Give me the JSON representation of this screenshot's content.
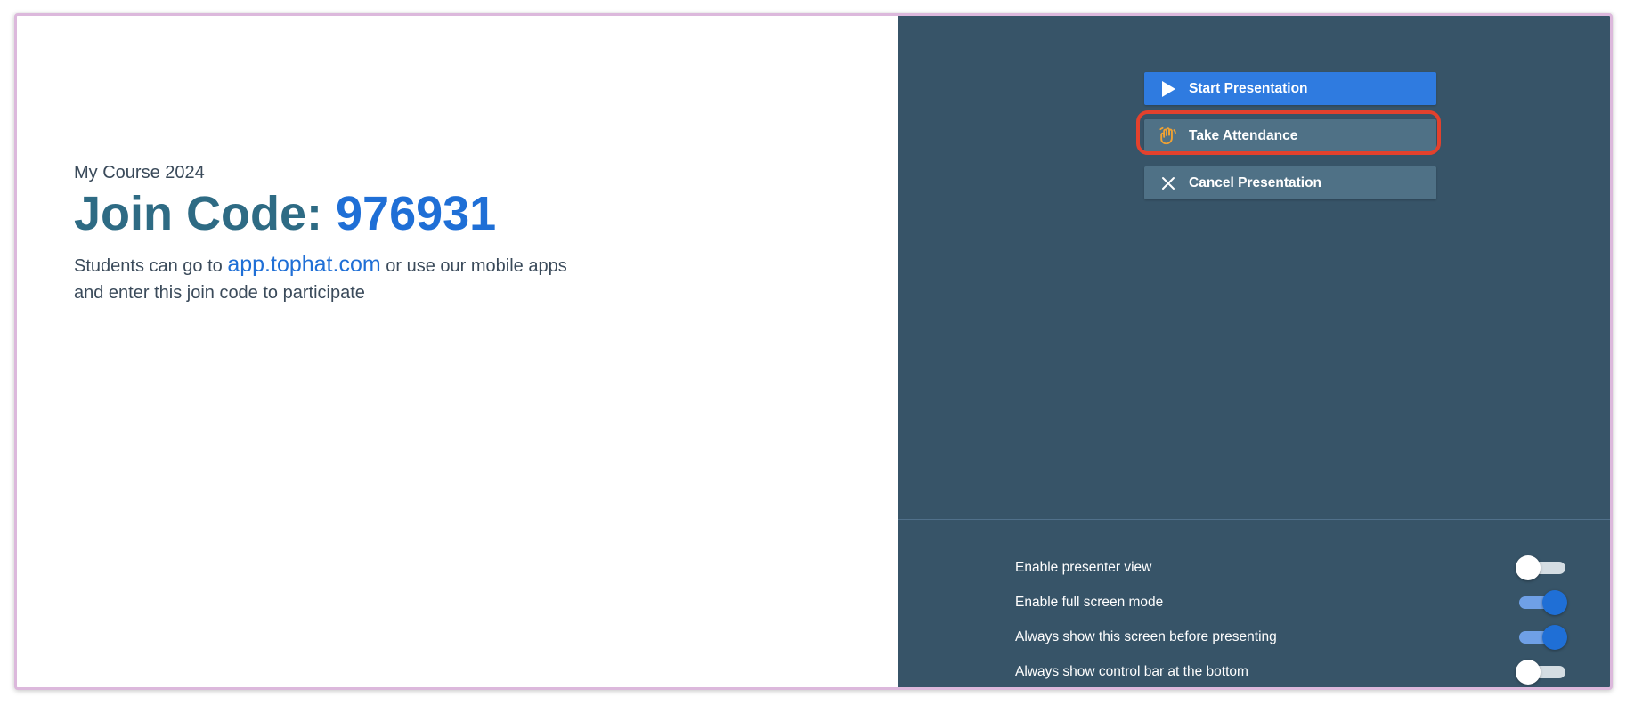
{
  "course": {
    "name": "My Course 2024",
    "join_label": "Join Code: ",
    "join_code": "976931",
    "desc_prefix": "Students can go to ",
    "link_text": "app.tophat.com",
    "desc_suffix": " or use our mobile apps and enter this join code to participate"
  },
  "actions": {
    "start_label": "Start Presentation",
    "attendance_label": "Take Attendance",
    "cancel_label": "Cancel Presentation"
  },
  "settings": [
    {
      "label": "Enable presenter view",
      "enabled": false
    },
    {
      "label": "Enable full screen mode",
      "enabled": true
    },
    {
      "label": "Always show this screen before presenting",
      "enabled": true
    },
    {
      "label": "Always show control bar at the bottom",
      "enabled": false
    }
  ],
  "icons": {
    "start": "play-icon",
    "attendance": "waving-hand-icon",
    "cancel": "close-icon"
  },
  "colors": {
    "primary": "#2f7be0",
    "panel": "#375468",
    "highlight": "#e3412d",
    "code": "#1f6fd6"
  }
}
